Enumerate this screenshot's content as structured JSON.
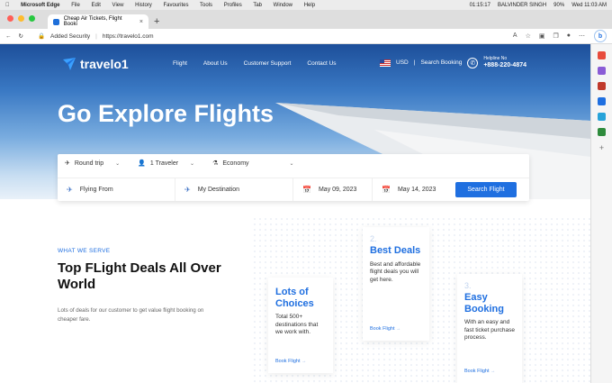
{
  "macbar": {
    "menu": [
      "Microsoft Edge",
      "File",
      "Edit",
      "View",
      "History",
      "Favourites",
      "Tools",
      "Profiles",
      "Tab",
      "Window",
      "Help"
    ],
    "time_small": "01:15:17",
    "user": "BALVINDER SINGH",
    "battery": "90%",
    "clock": "Wed 11:03 AM"
  },
  "browser": {
    "tab_title": "Cheap Air Tickets, Flight Booki",
    "security": "Added Security",
    "url": "https://travelo1.com"
  },
  "site": {
    "logo": "travelo1",
    "nav": [
      "Flight",
      "About Us",
      "Customer Support",
      "Contact Us"
    ],
    "currency": "USD",
    "search_booking": "Search Booking",
    "helpline_label": "Helpline No",
    "helpline_number": "+888-220-4874"
  },
  "hero": {
    "title": "Go Explore Flights"
  },
  "search": {
    "trip": "Round trip",
    "travelers": "1 Traveler",
    "cabin": "Economy",
    "from_placeholder": "Flying From",
    "dest_placeholder": "My Destination",
    "date1": "May 09, 2023",
    "date2": "May 14, 2023",
    "button": "Search Flight"
  },
  "serve": {
    "eyebrow": "WHAT WE SERVE",
    "title": "Top FLight Deals All Over World",
    "desc": "Lots of deals for our customer to get value flight booking on cheaper fare."
  },
  "cards": [
    {
      "num": "",
      "title": "Lots of Choices",
      "text": "Total 500+ destinations that we work with.",
      "link": "Book Flight"
    },
    {
      "num": "2.",
      "title": "Best Deals",
      "text": "Best and affordable flight deals you will get here.",
      "link": "Book Flight"
    },
    {
      "num": "3.",
      "title": "Easy Booking",
      "text": "With an easy and fast ticket purchase process.",
      "link": "Book Flight"
    }
  ],
  "colors": {
    "accent": "#1f6fe0"
  }
}
